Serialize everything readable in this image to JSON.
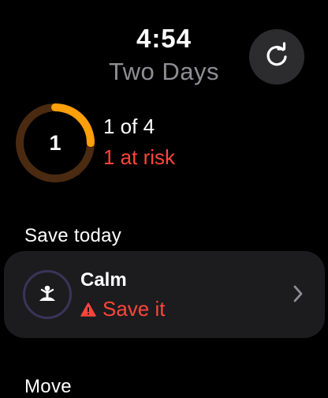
{
  "header": {
    "time": "4:54",
    "title": "Two Days"
  },
  "progress": {
    "center_number": "1",
    "count_text": "1 of 4",
    "risk_text": "1 at risk",
    "fraction": 0.25
  },
  "sections": {
    "save_today": "Save today",
    "move": "Move"
  },
  "card": {
    "title": "Calm",
    "status": "Save it"
  },
  "colors": {
    "ring_progress": "#ff9f0a",
    "ring_track": "#4a2a10",
    "risk": "#ff453a",
    "card_bg": "#1c1c1e"
  },
  "icons": {
    "refresh": "refresh-icon",
    "meditation": "meditation-icon",
    "warning": "warning-icon",
    "chevron": "chevron-right-icon"
  }
}
